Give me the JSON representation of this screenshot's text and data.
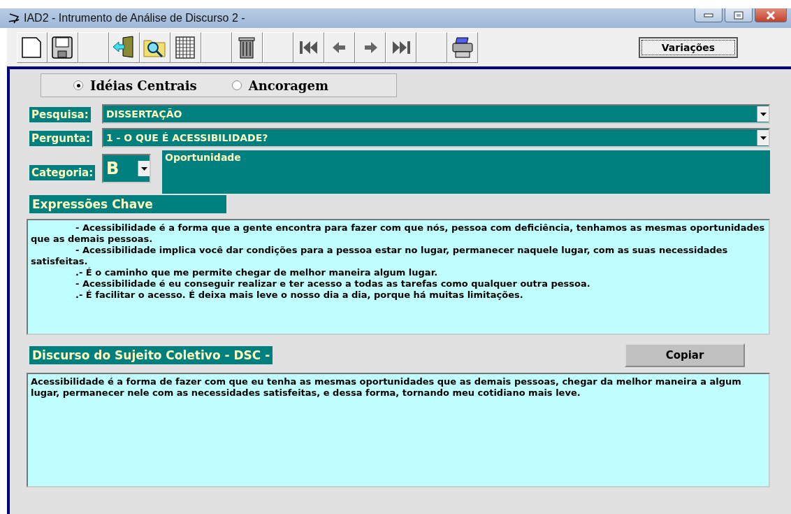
{
  "window": {
    "title": "IAD2 - Intrumento de Análise de Discurso 2  -"
  },
  "toolbar": {
    "variations_button": "Variações"
  },
  "mode_options": [
    {
      "label": "Idéias Centrais",
      "selected": true
    },
    {
      "label": "Ancoragem",
      "selected": false
    }
  ],
  "pesquisa": {
    "label": "Pesquisa:",
    "value": "DISSERTAÇÃO"
  },
  "pergunta": {
    "label": "Pergunta:",
    "value": "1 - O QUE É ACESSIBILIDADE?"
  },
  "categoria": {
    "label": "Categoria:",
    "value": "B",
    "description": "Oportunidade"
  },
  "key_expressions": {
    "heading": "Expressões Chave",
    "paragraphs": [
      "- Acessibilidade é a forma que a gente encontra para fazer com que nós, pessoa com deficiência, tenhamos as mesmas oportunidades que as demais pessoas.",
      "- Acessibilidade implica você dar condições para a pessoa estar no lugar, permanecer naquele lugar, com as suas necessidades satisfeitas.",
      ".- É o caminho que me permite chegar de melhor maneira algum lugar.",
      "- Acessibilidade é eu conseguir realizar e ter acesso a todas as tarefas como qualquer outra pessoa.",
      ".- É facilitar o acesso. É deixa mais leve o nosso dia a dia, porque há muitas limitações."
    ]
  },
  "dsc": {
    "heading": "Discurso do Sujeito Coletivo - DSC -",
    "copy_button": "Copiar",
    "text": "Acessibilidade é a forma de fazer com que eu tenha as mesmas oportunidades que as demais pessoas, chegar da melhor maneira a algum lugar, permanecer nele com as necessidades satisfeitas, e dessa forma, tornando meu cotidiano mais leve."
  }
}
